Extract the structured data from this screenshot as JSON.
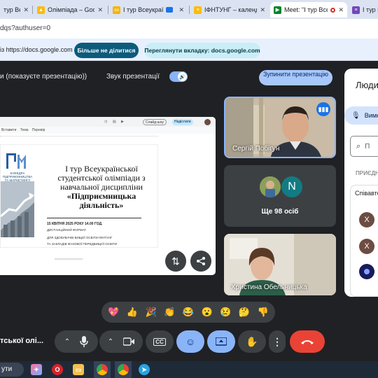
{
  "browser": {
    "tabs": [
      {
        "label": "тур Ве",
        "icon": "tab-favicon",
        "color": "#1a73e8"
      },
      {
        "label": "Олімпіада – Google",
        "icon": "google-drive-icon",
        "color": "#fbbc04"
      },
      {
        "label": "І тур Всеукраїнсь",
        "icon": "google-slides-icon",
        "color": "#f4b400"
      },
      {
        "label": "ІФНТУНГ – календар",
        "icon": "yellow-doc-icon",
        "color": "#fbbc04"
      },
      {
        "label": "Meet: \"І тур Всеу",
        "icon": "google-meet-icon",
        "color": "#00832d",
        "active": true
      },
      {
        "label": "І тур Всеук",
        "icon": "google-forms-icon",
        "color": "#7248b9"
      }
    ],
    "url": "dqs?authuser=0"
  },
  "share_banner": {
    "text": "із https://docs.google.com",
    "stop_sharing_label": "Більше не ділитися",
    "switch_tab_label": "Переглянути вкладку: docs.google.com"
  },
  "presentation_bar": {
    "presenting_label": "и (показуєте презентацію))",
    "sound_label": "Звук презентації",
    "stop_label": "Зупинити презентацію"
  },
  "shared_doc": {
    "toolbar_slideshow": "Слайд-шоу",
    "toolbar_share": "Надіслати",
    "menu": "Вставити  Тема  Перевір",
    "logo_caption": "КАФЕДРА ПІДПРИЄМНИЦТВА ТА МАРКЕТИНГУ",
    "title": "І тур Всеукраїнської студентської олімпіади з навчальної дисципліни",
    "title2": "«Підприємницька діяльність»",
    "date": "15 КВІТНЯ 2025 РОКУ 14.00 ГОД.",
    "format": "ДИСТАНЦІЙНИЙ ФОРМАТ",
    "audience1": "ДЛЯ ЗДОБУВАЧІВ ВИЩОЇ ОСВІТИ ІФНТУНГ",
    "audience2": "ТА ЗАКЛАДІВ ФАХОВОЇ ПЕРЕДВИЩОЇ ОСВІТИ"
  },
  "participants": {
    "tile1_name": "Сергій Побігун",
    "avatar_letter": "N",
    "more_label": "Ще 98 осіб",
    "tile3_name": "Христина Обельницька"
  },
  "side_panel": {
    "title": "Люди",
    "mute_all_label": "Вимкнути всім",
    "search_placeholder": "П",
    "in_meeting_label": "ПРИЄДНАНІ",
    "collaborators_label": "Співавтори",
    "people": [
      {
        "letter": "Х",
        "color": "#6d4c41"
      },
      {
        "letter": "Х",
        "color": "#6d4c41"
      },
      {
        "letter": "",
        "color": "#1a1a5e"
      }
    ]
  },
  "reactions": [
    "💖",
    "👍",
    "🎉",
    "👏",
    "😂",
    "😮",
    "😢",
    "🤔",
    "👎"
  ],
  "meeting": {
    "title": "тської олі..."
  },
  "taskbar": {
    "search_label": "ути"
  }
}
